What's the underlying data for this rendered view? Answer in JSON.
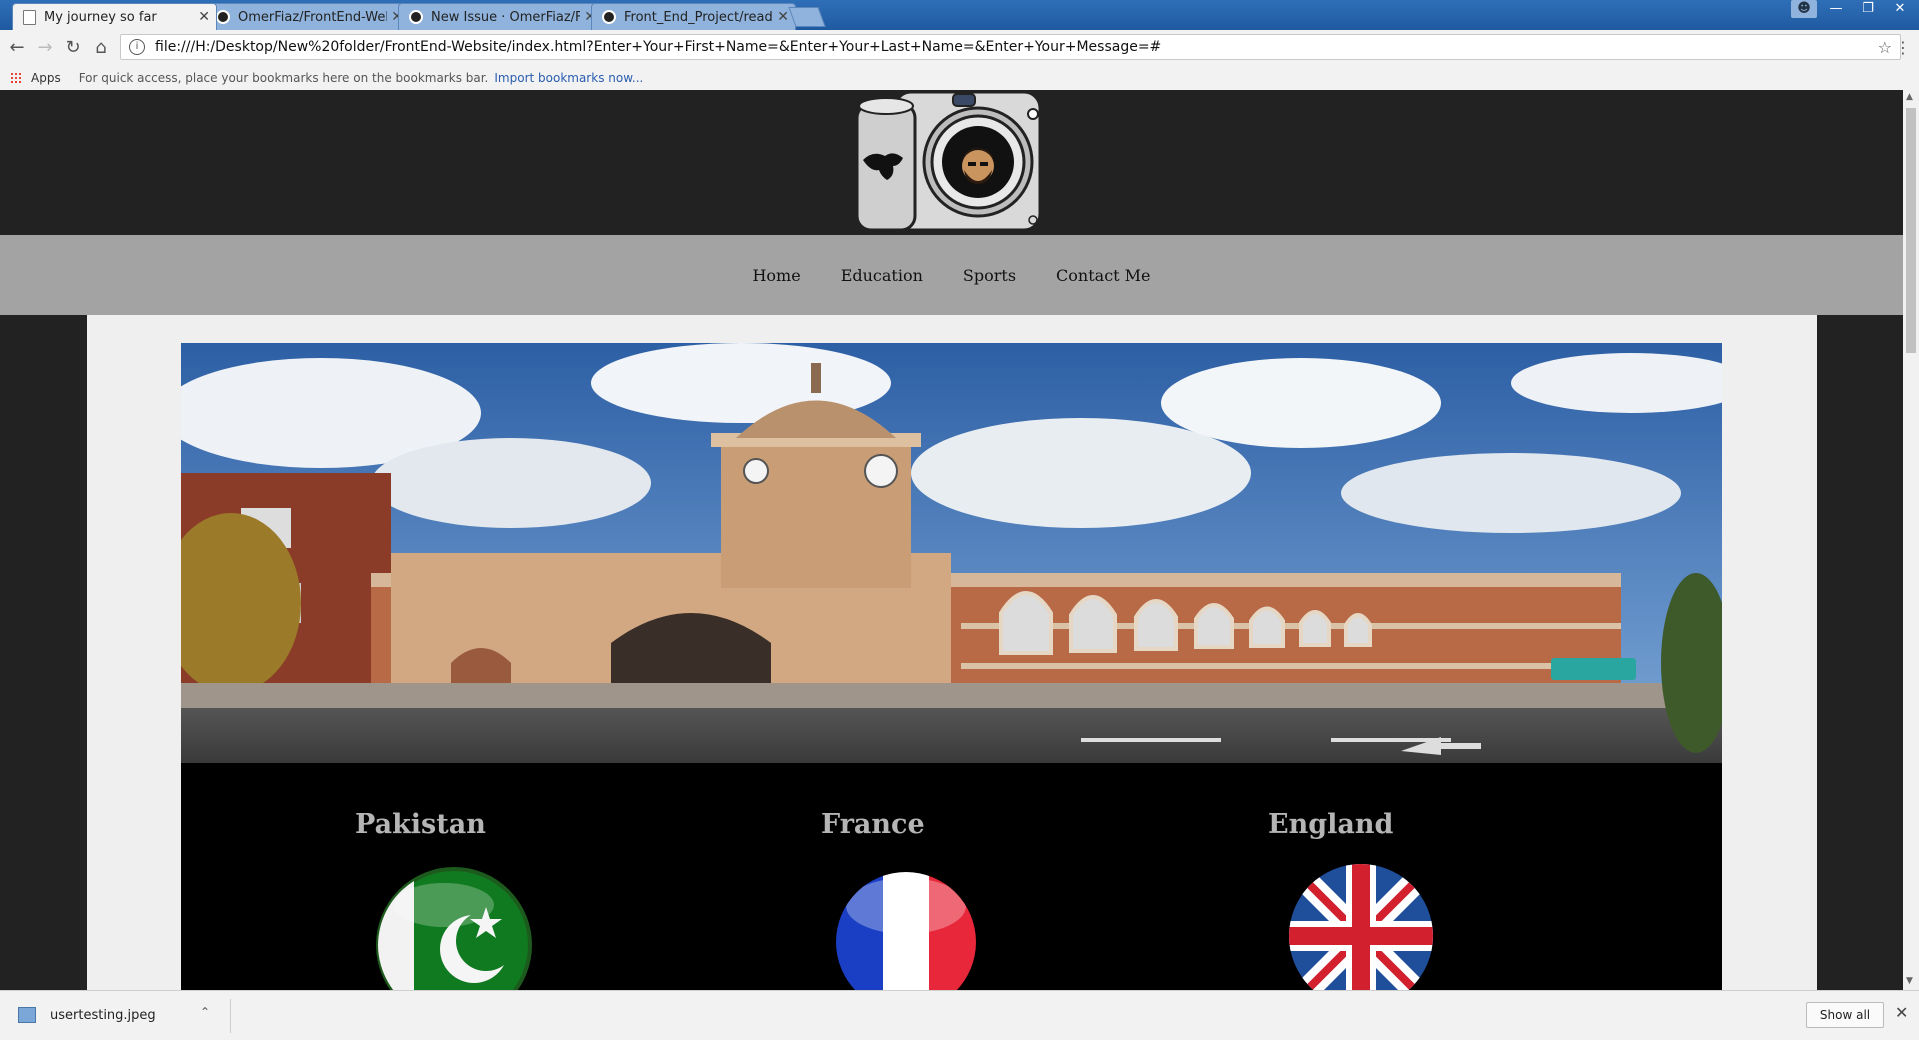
{
  "browser": {
    "tabs": [
      {
        "title": "My journey so far",
        "icon": "doc-icon",
        "active": true
      },
      {
        "title": "OmerFiaz/FrontEnd-Web",
        "icon": "github-icon",
        "active": false
      },
      {
        "title": "New Issue · OmerFiaz/Fr",
        "icon": "github-icon",
        "active": false
      },
      {
        "title": "Front_End_Project/readm",
        "icon": "github-icon",
        "active": false
      }
    ],
    "tab_close": "✕",
    "url": "file:///H:/Desktop/New%20folder/FrontEnd-Website/index.html?Enter+Your+First+Name=&Enter+Your+Last+Name=&Enter+Your+Message=#",
    "bookmarks": {
      "apps_label": "Apps",
      "hint": "For quick access, place your bookmarks here on the bookmarks bar.",
      "import_link": "Import bookmarks now..."
    }
  },
  "site": {
    "nav": [
      "Home",
      "Education",
      "Sports",
      "Contact Me"
    ],
    "countries": [
      "Pakistan",
      "France",
      "England"
    ]
  },
  "downloads": {
    "file": "usertesting.jpeg",
    "show_all": "Show all"
  },
  "colors": {
    "header_bg": "#222222",
    "nav_bg": "#a3a3a3",
    "content_bg": "#efefef",
    "countries_bg": "#000000",
    "country_text": "#b5b5b5"
  }
}
